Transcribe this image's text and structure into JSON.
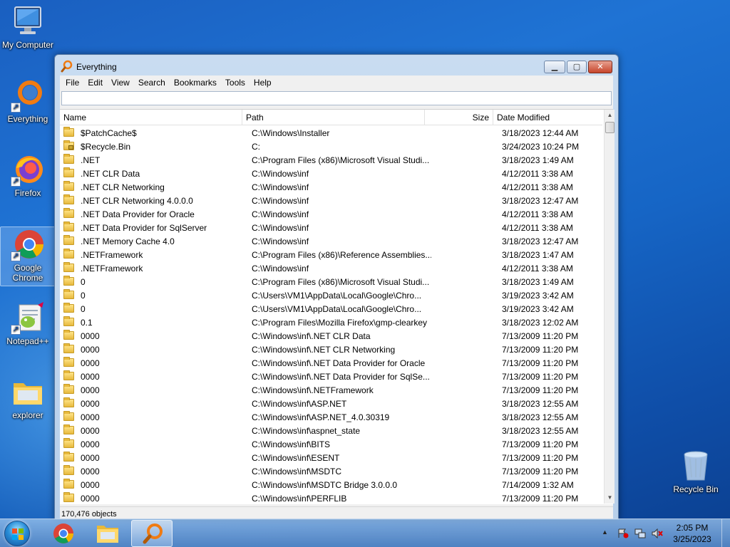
{
  "desktop": {
    "icons": [
      {
        "label": "My Computer"
      },
      {
        "label": "Everything"
      },
      {
        "label": "Firefox"
      },
      {
        "label": "Google Chrome"
      },
      {
        "label": "Notepad++"
      },
      {
        "label": "explorer"
      },
      {
        "label": "Recycle Bin"
      }
    ]
  },
  "window": {
    "title": "Everything",
    "menu": [
      "File",
      "Edit",
      "View",
      "Search",
      "Bookmarks",
      "Tools",
      "Help"
    ],
    "search": {
      "value": "",
      "placeholder": ""
    },
    "columns": {
      "name": "Name",
      "path": "Path",
      "size": "Size",
      "date": "Date Modified"
    },
    "rows": [
      {
        "name": "$PatchCache$",
        "path": "C:\\Windows\\Installer",
        "size": "",
        "date": "3/18/2023 12:44 AM"
      },
      {
        "name": "$Recycle.Bin",
        "path": "C:",
        "size": "",
        "date": "3/24/2023 10:24 PM"
      },
      {
        "name": ".NET",
        "path": "C:\\Program Files (x86)\\Microsoft Visual Studi...",
        "size": "",
        "date": "3/18/2023 1:49 AM"
      },
      {
        "name": ".NET CLR Data",
        "path": "C:\\Windows\\inf",
        "size": "",
        "date": "4/12/2011 3:38 AM"
      },
      {
        "name": ".NET CLR Networking",
        "path": "C:\\Windows\\inf",
        "size": "",
        "date": "4/12/2011 3:38 AM"
      },
      {
        "name": ".NET CLR Networking 4.0.0.0",
        "path": "C:\\Windows\\inf",
        "size": "",
        "date": "3/18/2023 12:47 AM"
      },
      {
        "name": ".NET Data Provider for Oracle",
        "path": "C:\\Windows\\inf",
        "size": "",
        "date": "4/12/2011 3:38 AM"
      },
      {
        "name": ".NET Data Provider for SqlServer",
        "path": "C:\\Windows\\inf",
        "size": "",
        "date": "4/12/2011 3:38 AM"
      },
      {
        "name": ".NET Memory Cache 4.0",
        "path": "C:\\Windows\\inf",
        "size": "",
        "date": "3/18/2023 12:47 AM"
      },
      {
        "name": ".NETFramework",
        "path": "C:\\Program Files (x86)\\Reference Assemblies...",
        "size": "",
        "date": "3/18/2023 1:47 AM"
      },
      {
        "name": ".NETFramework",
        "path": "C:\\Windows\\inf",
        "size": "",
        "date": "4/12/2011 3:38 AM"
      },
      {
        "name": "0",
        "path": "C:\\Program Files (x86)\\Microsoft Visual Studi...",
        "size": "",
        "date": "3/18/2023 1:49 AM"
      },
      {
        "name": "0",
        "path": "C:\\Users\\VM1\\AppData\\Local\\Google\\Chro...",
        "size": "",
        "date": "3/19/2023 3:42 AM"
      },
      {
        "name": "0",
        "path": "C:\\Users\\VM1\\AppData\\Local\\Google\\Chro...",
        "size": "",
        "date": "3/19/2023 3:42 AM"
      },
      {
        "name": "0.1",
        "path": "C:\\Program Files\\Mozilla Firefox\\gmp-clearkey",
        "size": "",
        "date": "3/18/2023 12:02 AM"
      },
      {
        "name": "0000",
        "path": "C:\\Windows\\inf\\.NET CLR Data",
        "size": "",
        "date": "7/13/2009 11:20 PM"
      },
      {
        "name": "0000",
        "path": "C:\\Windows\\inf\\.NET CLR Networking",
        "size": "",
        "date": "7/13/2009 11:20 PM"
      },
      {
        "name": "0000",
        "path": "C:\\Windows\\inf\\.NET Data Provider for Oracle",
        "size": "",
        "date": "7/13/2009 11:20 PM"
      },
      {
        "name": "0000",
        "path": "C:\\Windows\\inf\\.NET Data Provider for SqlSe...",
        "size": "",
        "date": "7/13/2009 11:20 PM"
      },
      {
        "name": "0000",
        "path": "C:\\Windows\\inf\\.NETFramework",
        "size": "",
        "date": "7/13/2009 11:20 PM"
      },
      {
        "name": "0000",
        "path": "C:\\Windows\\inf\\ASP.NET",
        "size": "",
        "date": "3/18/2023 12:55 AM"
      },
      {
        "name": "0000",
        "path": "C:\\Windows\\inf\\ASP.NET_4.0.30319",
        "size": "",
        "date": "3/18/2023 12:55 AM"
      },
      {
        "name": "0000",
        "path": "C:\\Windows\\inf\\aspnet_state",
        "size": "",
        "date": "3/18/2023 12:55 AM"
      },
      {
        "name": "0000",
        "path": "C:\\Windows\\inf\\BITS",
        "size": "",
        "date": "7/13/2009 11:20 PM"
      },
      {
        "name": "0000",
        "path": "C:\\Windows\\inf\\ESENT",
        "size": "",
        "date": "7/13/2009 11:20 PM"
      },
      {
        "name": "0000",
        "path": "C:\\Windows\\inf\\MSDTC",
        "size": "",
        "date": "7/13/2009 11:20 PM"
      },
      {
        "name": "0000",
        "path": "C:\\Windows\\inf\\MSDTC Bridge 3.0.0.0",
        "size": "",
        "date": "7/14/2009 1:32 AM"
      },
      {
        "name": "0000",
        "path": "C:\\Windows\\inf\\PERFLIB",
        "size": "",
        "date": "7/13/2009 11:20 PM"
      }
    ],
    "status": "170,476 objects"
  },
  "taskbar": {
    "clock_time": "2:05 PM",
    "clock_date": "3/25/2023"
  },
  "colors": {
    "desktop_blue": "#1f73d4",
    "close_red": "#c6452b"
  },
  "icons": [
    "folder-icon",
    "windows-logo-icon",
    "chrome-icon",
    "firefox-icon",
    "everything-magnifier-icon",
    "recycle-bin-icon",
    "notepadpp-icon",
    "explorer-folder-icon",
    "my-computer-icon",
    "shortcut-arrow-icon"
  ]
}
